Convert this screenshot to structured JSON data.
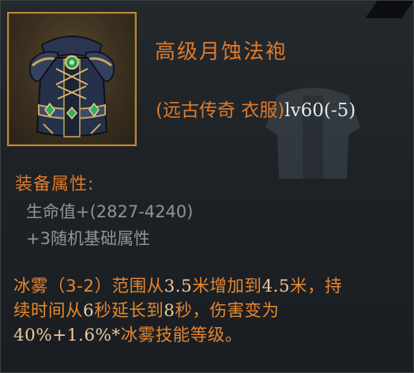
{
  "item": {
    "name": "高级月蚀法袍",
    "type": "(远古传奇 衣服)",
    "level": "lv60(-5)",
    "icon": "robe-icon"
  },
  "attributes": {
    "title": "装备属性:",
    "lines": [
      "生命值+(2827-4240)",
      "+3随机基础属性"
    ]
  },
  "effect": {
    "text_parts": [
      {
        "t": "冰雾（3-2）范围从",
        "style": "text"
      },
      {
        "t": "3.5",
        "style": "num"
      },
      {
        "t": "米增加到",
        "style": "text"
      },
      {
        "t": "4.5",
        "style": "num"
      },
      {
        "t": "米，持续时间从",
        "style": "text"
      },
      {
        "t": "6",
        "style": "num"
      },
      {
        "t": "秒延长到",
        "style": "text"
      },
      {
        "t": "8",
        "style": "num"
      },
      {
        "t": "秒，伤害变为",
        "style": "text"
      },
      {
        "t": "40%+1.6%*",
        "style": "num"
      },
      {
        "t": "冰雾技能等级。",
        "style": "text"
      }
    ]
  },
  "colors": {
    "orange_text": "#e07a2c",
    "stat_gray": "#8e9499",
    "frame_gold": "#b58a3a"
  }
}
